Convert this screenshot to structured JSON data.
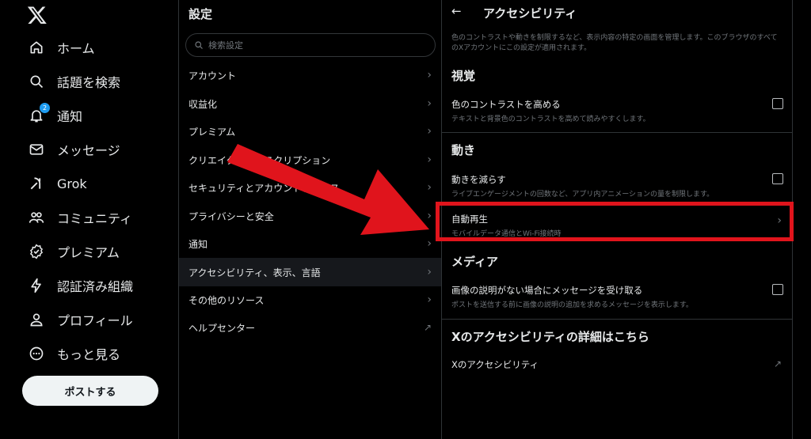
{
  "nav": {
    "items": [
      {
        "id": "home",
        "icon": "home-icon",
        "label": "ホーム"
      },
      {
        "id": "explore",
        "icon": "search-icon",
        "label": "話題を検索"
      },
      {
        "id": "notifications",
        "icon": "bell-icon",
        "label": "通知",
        "badge": "2"
      },
      {
        "id": "messages",
        "icon": "mail-icon",
        "label": "メッセージ"
      },
      {
        "id": "grok",
        "icon": "grok-icon",
        "label": "Grok"
      },
      {
        "id": "communities",
        "icon": "people-icon",
        "label": "コミュニティ"
      },
      {
        "id": "premium",
        "icon": "verified-icon",
        "label": "プレミアム"
      },
      {
        "id": "verified-orgs",
        "icon": "bolt-icon",
        "label": "認証済み組織"
      },
      {
        "id": "profile",
        "icon": "user-icon",
        "label": "プロフィール"
      },
      {
        "id": "more",
        "icon": "more-icon",
        "label": "もっと見る"
      }
    ],
    "post_button": "ポストする"
  },
  "settings": {
    "title": "設定",
    "search_placeholder": "検索設定",
    "items": [
      {
        "label": "アカウント",
        "icon": "chevron-right-icon"
      },
      {
        "label": "収益化",
        "icon": "chevron-right-icon"
      },
      {
        "label": "プレミアム",
        "icon": "chevron-right-icon"
      },
      {
        "label": "クリエイターサブスクリプション",
        "icon": "chevron-right-icon"
      },
      {
        "label": "セキュリティとアカウントアクセス",
        "icon": "chevron-right-icon"
      },
      {
        "label": "プライバシーと安全",
        "icon": "chevron-right-icon"
      },
      {
        "label": "通知",
        "icon": "chevron-right-icon"
      },
      {
        "label": "アクセシビリティ、表示、言語",
        "icon": "chevron-right-icon",
        "active": true
      },
      {
        "label": "その他のリソース",
        "icon": "chevron-right-icon"
      },
      {
        "label": "ヘルプセンター",
        "icon": "external-link-icon"
      }
    ]
  },
  "detail": {
    "title": "アクセシビリティ",
    "intro": "色のコントラストや動きを制限するなど、表示内容の特定の画面を管理します。このブラウザのすべてのXアカウントにこの設定が適用されます。",
    "sections": {
      "vision": "視覚",
      "motion": "動き",
      "media": "メディア",
      "more": "Xのアクセシビリティの詳細はこちら"
    },
    "contrast": {
      "title": "色のコントラストを高める",
      "sub": "テキストと背景色のコントラストを高めて読みやすくします。",
      "checked": false
    },
    "reduce_motion": {
      "title": "動きを減らす",
      "sub": "ライブエンゲージメントの回数など、アプリ内アニメーションの量を制限します。",
      "checked": false
    },
    "autoplay": {
      "title": "自動再生",
      "sub": "モバイルデータ通信とWi-Fi接続時"
    },
    "image_desc": {
      "title": "画像の説明がない場合にメッセージを受け取る",
      "sub": "ポストを送信する前に画像の説明の追加を求めるメッセージを表示します。",
      "checked": false
    },
    "link": "Xのアクセシビリティ"
  },
  "colors": {
    "accent": "#1d9bf0",
    "highlight": "#e0141c"
  }
}
